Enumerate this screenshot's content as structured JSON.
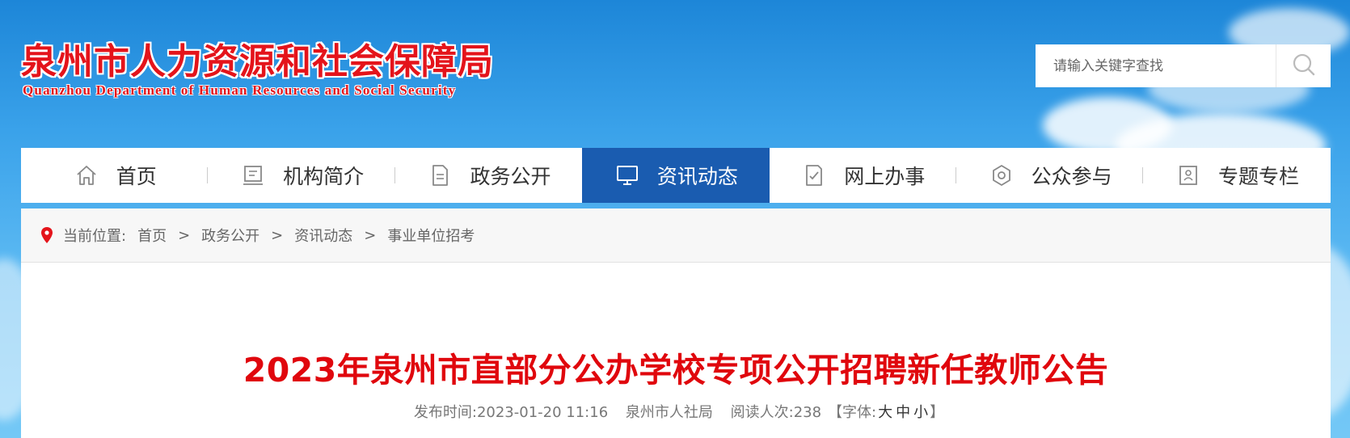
{
  "header": {
    "logo_cn": "泉州市人力资源和社会保障局",
    "logo_en": "Quanzhou Department of Human Resources and Social Security",
    "search_placeholder": "请输入关键字查找",
    "search_icon": "search-icon"
  },
  "nav": {
    "items": [
      {
        "label": "首页",
        "icon": "home-icon"
      },
      {
        "label": "机构简介",
        "icon": "organization-icon"
      },
      {
        "label": "政务公开",
        "icon": "document-icon"
      },
      {
        "label": "资讯动态",
        "icon": "monitor-icon",
        "active": true
      },
      {
        "label": "网上办事",
        "icon": "checklist-icon"
      },
      {
        "label": "公众参与",
        "icon": "badge-icon"
      },
      {
        "label": "专题专栏",
        "icon": "portrait-icon"
      }
    ],
    "active_color": "#1a5cb0"
  },
  "breadcrumb": {
    "prefix": "当前位置:",
    "items": [
      "首页",
      "政务公开",
      "资讯动态",
      "事业单位招考"
    ],
    "separator": ">"
  },
  "article": {
    "title": "2023年泉州市直部分公办学校专项公开招聘新任教师公告",
    "publish_label": "发布时间:",
    "publish_time": "2023-01-20 11:16",
    "source": "泉州市人社局",
    "read_label": "阅读人次:",
    "read_count": "238",
    "font_open": "【字体:",
    "font_large": "大",
    "font_medium": "中",
    "font_small": "小",
    "font_close": "】"
  },
  "colors": {
    "brand_red": "#e4141b",
    "title_red": "#e0070d"
  }
}
